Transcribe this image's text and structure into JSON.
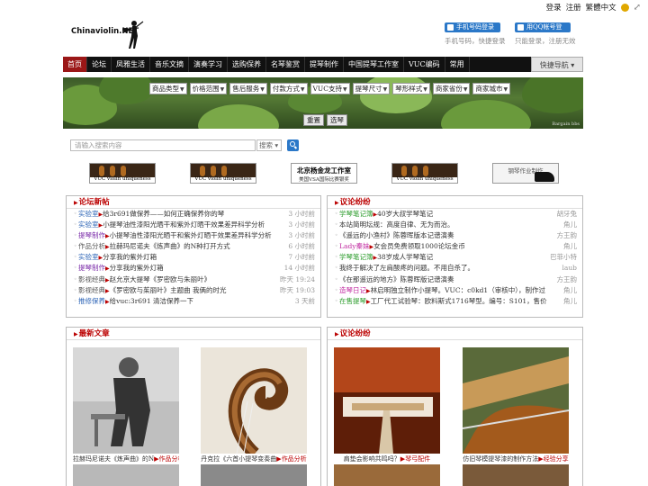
{
  "top": {
    "login": "登录",
    "register": "注册",
    "traditional": "繁體中文"
  },
  "logo": {
    "text": "Chinaviolin.NET"
  },
  "login": {
    "phone_btn": "手机号码登录",
    "phone_sub": "手机号码，快捷登录",
    "qq_btn": "用QQ帐号登录",
    "qq_sub": "只能登录，注册无效"
  },
  "nav": {
    "items": [
      "首页",
      "论坛",
      "凤雅生活",
      "音乐文摘",
      "演奏学习",
      "选购保养",
      "名琴鉴赏",
      "提琴制作",
      "中国提琴工作室",
      "VUC编码",
      "常用"
    ],
    "quick": "快捷导航"
  },
  "filters": [
    "商品类型",
    "价格范围",
    "售后服务",
    "付款方式",
    "VUC支持",
    "提琴尺寸",
    "琴形样式",
    "商家省份",
    "商家城市"
  ],
  "buttons": {
    "reset": "重置",
    "select": "选琴"
  },
  "banner_watermark": "Bargain bbs",
  "search": {
    "placeholder": "请输入搜索内容",
    "scope": "搜索"
  },
  "ads": [
    {
      "caption": "VUC violin uniqueness code"
    },
    {
      "caption": "VUC violin uniqueness code"
    },
    {
      "title": "北京杨金龙工作室",
      "sub": "美国VSA国际比赛银奖"
    },
    {
      "caption": "VUC violin uniqueness code"
    },
    {
      "title": "钢琴作业制作"
    }
  ],
  "forum": {
    "title": "论坛新帖",
    "rows": [
      {
        "cat": "实验室",
        "text": "给3r691做保养——如何正确保养你的琴",
        "time": "3 小时前"
      },
      {
        "cat": "实验室",
        "text": "小提琴油性漆阳光晒干和紫外灯晒干效果差异科学分析",
        "time": "3 小时前"
      },
      {
        "cat": "提琴制作",
        "text": "小提琴油性漆阳光晒干和紫外灯晒干效果差异科学分析",
        "time": "3 小时前"
      },
      {
        "cat": "作品分析",
        "text": "拉赫玛尼诺夫《炼声曲》的N种打开方式",
        "time": "6 小时前"
      },
      {
        "cat": "实验室",
        "text": "分享我的紫外灯箱",
        "time": "7 小时前"
      },
      {
        "cat": "提琴制作",
        "text": "分享我的紫外灯箱",
        "time": "14 小时前"
      },
      {
        "cat": "影视经典",
        "text": "赵允京大提琴《罗密欧与朱丽叶》",
        "time": "昨天 19:24"
      },
      {
        "cat": "影视经典",
        "text": "《罗密欧与茱丽叶》主题曲 我俩的时光",
        "time": "昨天 19:03"
      },
      {
        "cat": "推修保养",
        "text": "给vuc:3r691 清洁保养一下",
        "time": "3 天前"
      }
    ]
  },
  "discuss": {
    "title": "议论纷纷",
    "rows": [
      {
        "cat": "学琴笔记簿",
        "text": "40岁大叔学琴笔记",
        "time": "胡牙兔"
      },
      {
        "cat": "",
        "text": "本站简明坛规：高度自律、无为而治。",
        "time": "角儿"
      },
      {
        "cat": "",
        "text": "《遥远的小渔村》陈蓉晖版本记谱演奏",
        "time": "方王韵"
      },
      {
        "cat": "Lady秦妹",
        "text": "女会员免费领取1000论坛金币",
        "time": "角儿"
      },
      {
        "cat": "学琴笔记簿",
        "text": "38岁成人学琴笔记",
        "time": "巴菲小特"
      },
      {
        "cat": "",
        "text": "我终于解决了左肩酸疼的问题。不用自杀了。",
        "time": "laub"
      },
      {
        "cat": "",
        "text": "《在那遥远的地方》陈蓉晖版记谱演奏",
        "time": "方王韵"
      },
      {
        "cat": "造琴日记",
        "text": "林启明独立制作小提琴。VUC：c0kd1（审核中），制作过",
        "time": "角儿"
      },
      {
        "cat": "在售提琴",
        "text": "工厂代工试验琴：欧料斯式1716琴型。编号：S101，售价",
        "time": "角儿"
      }
    ]
  },
  "articles": {
    "title": "最新文章",
    "cards": [
      {
        "text": "拉赫玛尼诺夫《炼声曲》的N",
        "tag": "作品分析"
      },
      {
        "text": "丹克拉《六首小提琴变奏曲",
        "tag": "作品分析"
      }
    ]
  },
  "discuss2": {
    "title": "议论纷纷",
    "cards": [
      {
        "text": "肩垫会影响共鸣吗？",
        "tag": "琴弓配件"
      },
      {
        "text": "仿旧琴模提琴漆的制作方法",
        "tag": "经验分享"
      }
    ]
  }
}
